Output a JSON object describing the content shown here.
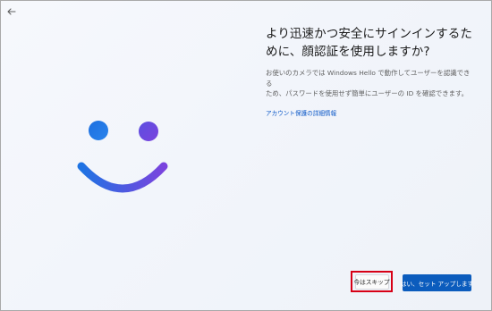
{
  "window": {
    "back_icon": "back-arrow-icon"
  },
  "illustration": {
    "icon": "smiling-face-icon",
    "colors": {
      "start": "#1e73e3",
      "end": "#7a43de"
    }
  },
  "content": {
    "headline": "より迅速かつ安全にサインインするた\nめに、顔認証を使用しますか?",
    "description": "お使いのカメラでは Windows Hello で動作してユーザーを認識できる\nため、パスワードを使用せず簡単にユーザーの ID を確認できます。",
    "link": "アカウント保護の詳細情報"
  },
  "actions": {
    "skip_label": "今はスキップ",
    "setup_label": "はい、セット アップします"
  },
  "colors": {
    "accent": "#0b5cbd",
    "highlight": "#d70016",
    "link": "#0b57c7"
  }
}
